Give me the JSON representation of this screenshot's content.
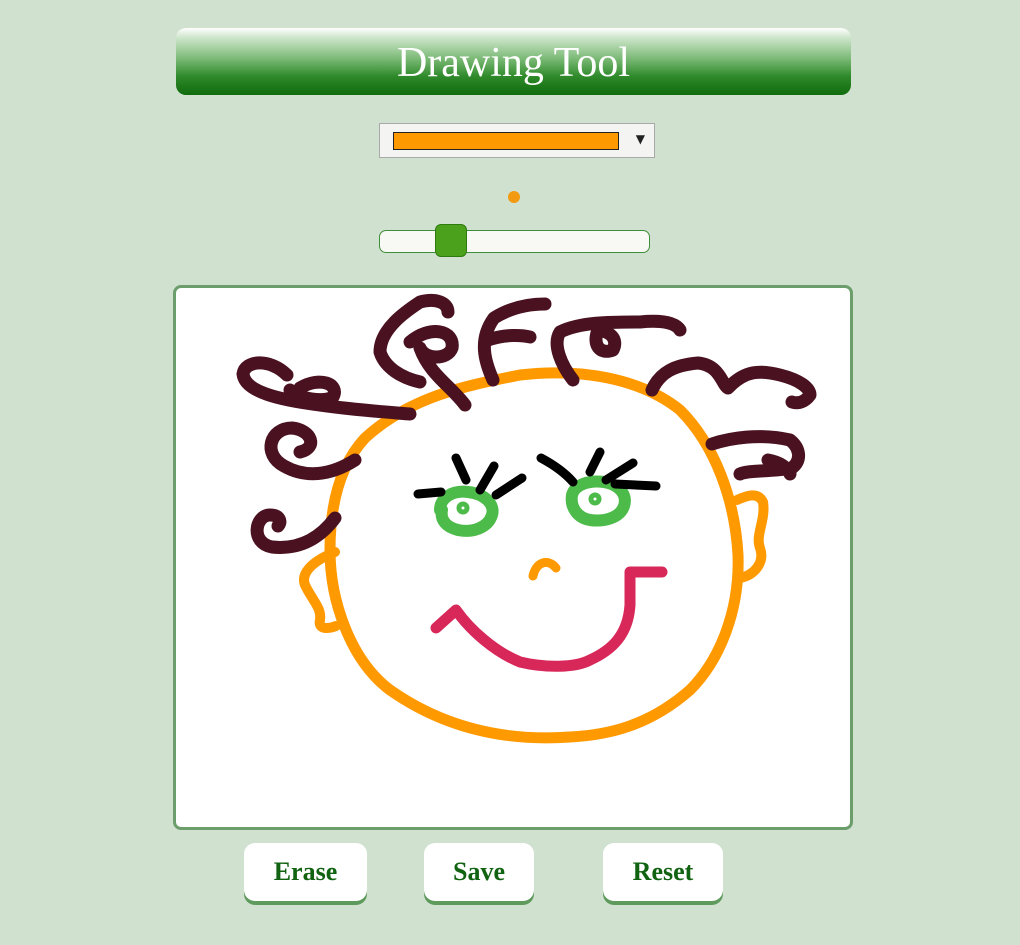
{
  "header": {
    "title": "Drawing Tool"
  },
  "color_select": {
    "selected_color": "#ff9900"
  },
  "brush_preview": {
    "color": "#f29a10"
  },
  "size_slider": {
    "value_fraction": 0.23
  },
  "buttons": {
    "erase": "Erase",
    "save": "Save",
    "reset": "Reset"
  },
  "colors": {
    "background": "#d1e1d0",
    "accent_green": "#116312",
    "canvas_border": "#6c9e6b",
    "hair": "#4a1120",
    "face": "#ff9900",
    "eyes": "#4dbb4a",
    "lashes": "#000000",
    "mouth": "#d8285a"
  },
  "canvas": {
    "strokes": [
      {
        "part": "face-outline",
        "color": "#ff9900",
        "width": 11
      },
      {
        "part": "ear-left",
        "color": "#ff9900",
        "width": 10
      },
      {
        "part": "ear-right",
        "color": "#ff9900",
        "width": 10
      },
      {
        "part": "nose",
        "color": "#ff9900",
        "width": 9
      },
      {
        "part": "eye-left",
        "color": "#4dbb4a",
        "width": 12
      },
      {
        "part": "eye-right",
        "color": "#4dbb4a",
        "width": 12
      },
      {
        "part": "lashes-left",
        "color": "#000000",
        "width": 9
      },
      {
        "part": "lashes-right",
        "color": "#000000",
        "width": 9
      },
      {
        "part": "mouth",
        "color": "#d8285a",
        "width": 11
      },
      {
        "part": "hair-curls",
        "color": "#4a1120",
        "width": 13
      }
    ]
  }
}
